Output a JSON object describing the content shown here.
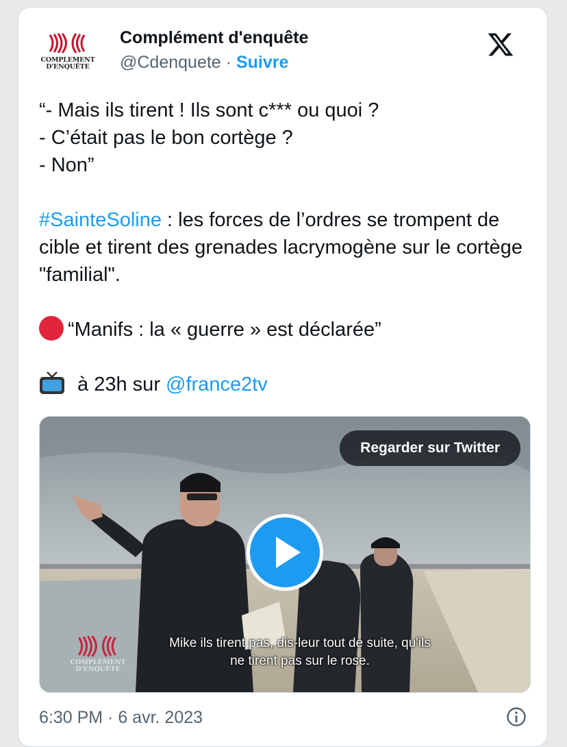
{
  "author": {
    "name": "Complément d'enquête",
    "handle": "@Cdenquete",
    "separator": "·",
    "follow_label": "Suivre",
    "logo_text_line1": "COMPLEMENT",
    "logo_text_line2": "D'ENQUÊTE"
  },
  "tweet": {
    "lines": [
      "“- Mais ils tirent ! Ils sont c*** ou quoi ?",
      "- C’était pas le bon cortège ?",
      "- Non”"
    ],
    "hashtag": "#SainteSoline",
    "paragraph2": " : les forces de l’ordres se trompent de cible et tirent des grenades lacrymogène sur le cortège \"familial\".",
    "headline": "“Manifs : la « guerre » est déclarée”",
    "broadcast_prefix": " à 23h sur ",
    "mention": "@france2tv"
  },
  "media": {
    "watch_label": "Regarder sur Twitter",
    "subtitle_line1": "Mike ils tirent pas, dis-leur tout de suite, qu'ils",
    "subtitle_line2": "ne tirent pas sur le rose.",
    "watermark_line1": "COMPLÉMENT",
    "watermark_line2": "D'ENQUÊTE"
  },
  "footer": {
    "timestamp": "6:30 PM · 6 avr. 2023"
  },
  "colors": {
    "accent": "#1d9bf0",
    "text": "#0f1419",
    "muted": "#536471",
    "brand_red": "#c8102e",
    "emoji_red": "#e0243b"
  },
  "icons": [
    "x-logo-icon",
    "red-circle-icon",
    "tv-icon",
    "play-icon",
    "info-icon"
  ]
}
